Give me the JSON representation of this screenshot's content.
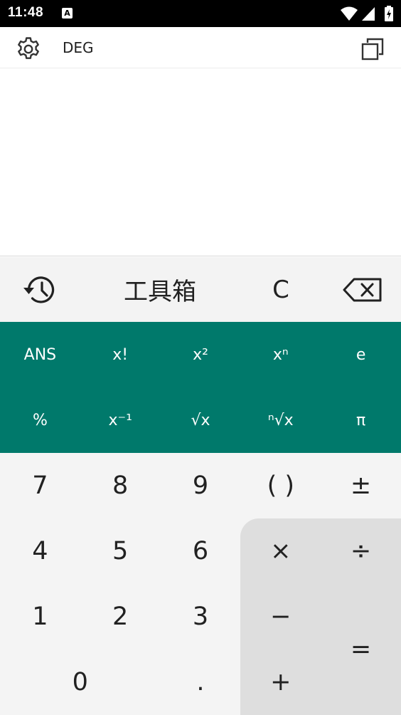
{
  "status": {
    "time": "11:48",
    "notification_letter": "A"
  },
  "header": {
    "angle_mode": "DEG"
  },
  "tools": {
    "toolbox_label": "工具箱",
    "clear_label": "C"
  },
  "scientific": {
    "row1": [
      "ANS",
      "x!",
      "x²",
      "xⁿ",
      "e"
    ],
    "row2": [
      "%",
      "x⁻¹",
      "√x",
      "ⁿ√x",
      "π"
    ]
  },
  "keys": {
    "seven": "7",
    "eight": "8",
    "nine": "9",
    "parens": "( )",
    "plus_minus": "±",
    "four": "4",
    "five": "5",
    "six": "6",
    "multiply": "×",
    "divide": "÷",
    "one": "1",
    "two": "2",
    "three": "3",
    "minus": "−",
    "equals": "=",
    "zero": "0",
    "decimal": ".",
    "plus": "+"
  },
  "colors": {
    "scientific_pad": "#00796b",
    "number_pad": "#f4f4f4",
    "operator_area": "#dedede",
    "tool_row": "#f3f3f3"
  }
}
